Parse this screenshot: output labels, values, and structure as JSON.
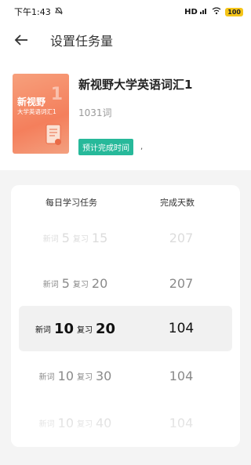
{
  "status_bar": {
    "time": "下午1:43",
    "signal": "HD",
    "battery": "100",
    "icons": [
      "mute-icon",
      "signal-icon",
      "wifi-icon",
      "battery-icon"
    ]
  },
  "header": {
    "title": "设置任务量",
    "back_icon": "back-arrow-icon"
  },
  "book": {
    "title": "新视野大学英语词汇1",
    "word_count": "1031词",
    "eta_label": "预计完成时间",
    "eta_value": ",",
    "cover": {
      "title": "新视野",
      "subtitle": "大学英语词汇1",
      "number": "1"
    }
  },
  "picker": {
    "col_task": "每日学习任务",
    "col_days": "完成天数",
    "rows": [
      {
        "new_label": "新词",
        "new": "5",
        "review_label": "复习",
        "review": "15",
        "days": "207"
      },
      {
        "new_label": "新词",
        "new": "5",
        "review_label": "复习",
        "review": "20",
        "days": "207"
      },
      {
        "new_label": "新词",
        "new": "10",
        "review_label": "复习",
        "review": "20",
        "days": "104"
      },
      {
        "new_label": "新词",
        "new": "10",
        "review_label": "复习",
        "review": "30",
        "days": "104"
      },
      {
        "new_label": "新词",
        "new": "10",
        "review_label": "复习",
        "review": "40",
        "days": "104"
      }
    ],
    "selected_index": 2
  },
  "colors": {
    "accent": "#27b99a",
    "cover": "#f47f5c"
  }
}
